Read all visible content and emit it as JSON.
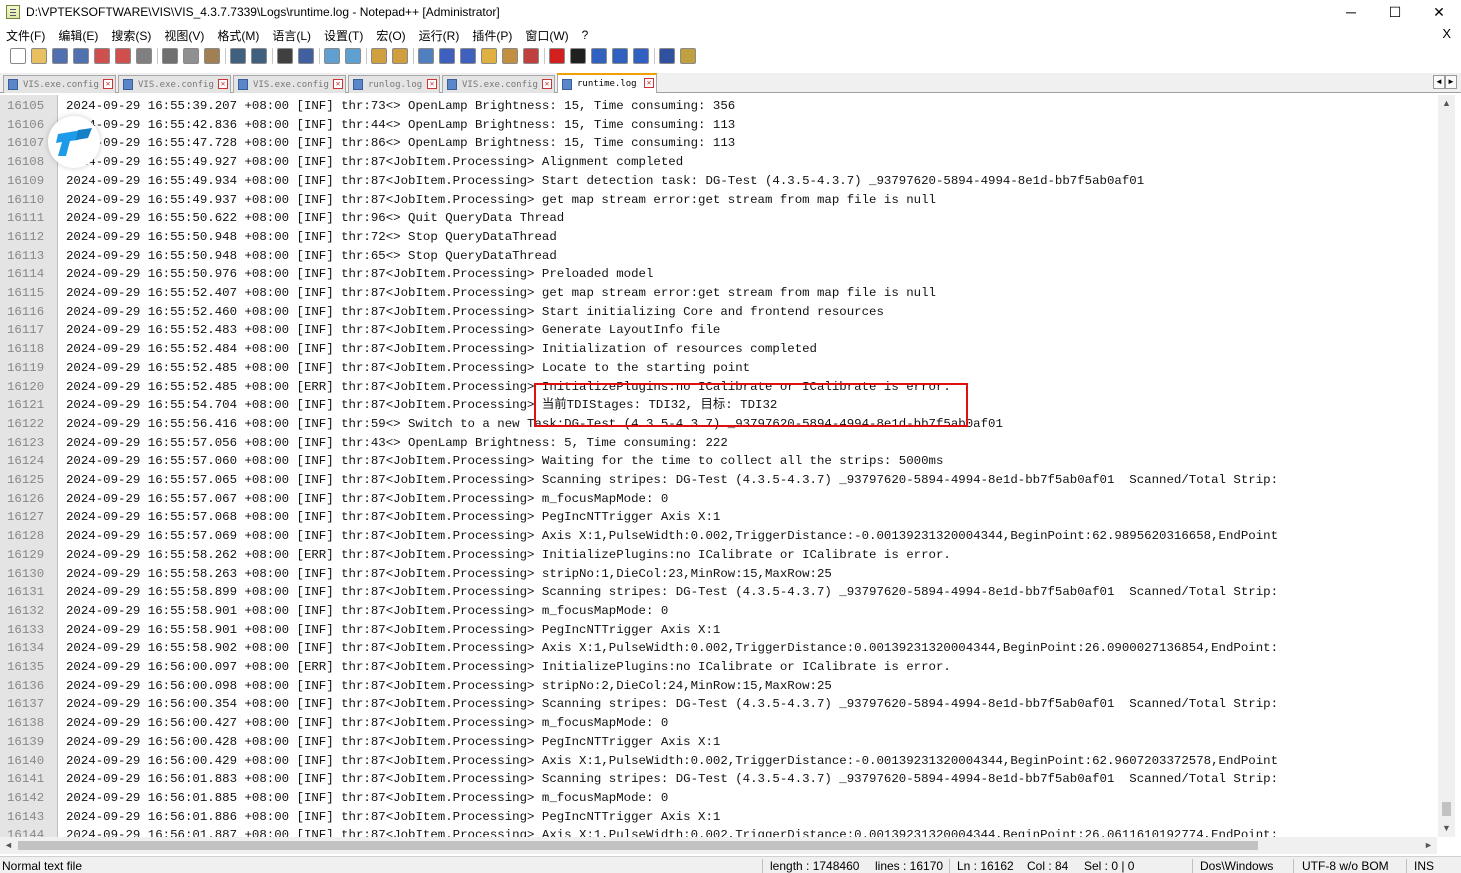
{
  "window": {
    "title": "D:\\VPTEKSOFTWARE\\VIS\\VIS_4.3.7.7339\\Logs\\runtime.log - Notepad++ [Administrator]",
    "minimize": "─",
    "maximize": "☐",
    "close": "✕"
  },
  "menu": {
    "items": [
      "文件(F)",
      "编辑(E)",
      "搜索(S)",
      "视图(V)",
      "格式(M)",
      "语言(L)",
      "设置(T)",
      "宏(O)",
      "运行(R)",
      "插件(P)",
      "窗口(W)",
      "?"
    ],
    "close_doc": "X"
  },
  "toolbar": {
    "icons": [
      {
        "name": "new-file-icon",
        "color": "#ffffff"
      },
      {
        "name": "open-file-icon",
        "color": "#e8c060"
      },
      {
        "name": "save-icon",
        "color": "#5070b0"
      },
      {
        "name": "save-all-icon",
        "color": "#5070b0"
      },
      {
        "name": "close-icon",
        "color": "#d05050"
      },
      {
        "name": "close-all-icon",
        "color": "#d05050"
      },
      {
        "name": "print-icon",
        "color": "#808080"
      },
      {
        "name": "sep",
        "color": ""
      },
      {
        "name": "cut-icon",
        "color": "#707070"
      },
      {
        "name": "copy-icon",
        "color": "#909090"
      },
      {
        "name": "paste-icon",
        "color": "#a08050"
      },
      {
        "name": "sep",
        "color": ""
      },
      {
        "name": "undo-icon",
        "color": "#406080"
      },
      {
        "name": "redo-icon",
        "color": "#406080"
      },
      {
        "name": "sep",
        "color": ""
      },
      {
        "name": "find-icon",
        "color": "#404040"
      },
      {
        "name": "replace-icon",
        "color": "#4060a0"
      },
      {
        "name": "sep",
        "color": ""
      },
      {
        "name": "zoom-in-icon",
        "color": "#60a0d0"
      },
      {
        "name": "zoom-out-icon",
        "color": "#60a0d0"
      },
      {
        "name": "sep",
        "color": ""
      },
      {
        "name": "sync-vertical-icon",
        "color": "#d0a040"
      },
      {
        "name": "sync-horizontal-icon",
        "color": "#d0a040"
      },
      {
        "name": "sep",
        "color": ""
      },
      {
        "name": "word-wrap-icon",
        "color": "#5080c0"
      },
      {
        "name": "show-all-chars-icon",
        "color": "#4060c0"
      },
      {
        "name": "indent-guide-icon",
        "color": "#4060c0"
      },
      {
        "name": "user-lang-icon",
        "color": "#e0b040"
      },
      {
        "name": "doc-map-icon",
        "color": "#c09040"
      },
      {
        "name": "function-list-icon",
        "color": "#c04040"
      },
      {
        "name": "sep",
        "color": ""
      },
      {
        "name": "record-macro-icon",
        "color": "#d02020"
      },
      {
        "name": "stop-record-icon",
        "color": "#202020"
      },
      {
        "name": "play-macro-icon",
        "color": "#3060c0"
      },
      {
        "name": "run-macro-multiple-icon",
        "color": "#3060c0"
      },
      {
        "name": "save-macro-icon",
        "color": "#3060c0"
      },
      {
        "name": "sep",
        "color": ""
      },
      {
        "name": "spell-check-icon",
        "color": "#3050a0"
      },
      {
        "name": "clipboard-history-icon",
        "color": "#c0a040"
      }
    ]
  },
  "tabs": [
    {
      "label": "VIS.exe.config",
      "active": false
    },
    {
      "label": "VIS.exe.config",
      "active": false
    },
    {
      "label": "VIS.exe.config",
      "active": false
    },
    {
      "label": "runlog.log",
      "active": false
    },
    {
      "label": "VIS.exe.config",
      "active": false
    },
    {
      "label": "runtime.log",
      "active": true
    }
  ],
  "tab_scroll": {
    "left": "◄",
    "right": "►"
  },
  "editor": {
    "lines": [
      {
        "n": "16105",
        "t": "2024-09-29 16:55:39.207 +08:00 [INF] thr:73<> OpenLamp Brightness: 15, Time consuming: 356"
      },
      {
        "n": "16106",
        "t": "2024-09-29 16:55:42.836 +08:00 [INF] thr:44<> OpenLamp Brightness: 15, Time consuming: 113"
      },
      {
        "n": "16107",
        "t": "2024-09-29 16:55:47.728 +08:00 [INF] thr:86<> OpenLamp Brightness: 15, Time consuming: 113"
      },
      {
        "n": "16108",
        "t": "2024-09-29 16:55:49.927 +08:00 [INF] thr:87<JobItem.Processing> Alignment completed"
      },
      {
        "n": "16109",
        "t": "2024-09-29 16:55:49.934 +08:00 [INF] thr:87<JobItem.Processing> Start detection task: DG-Test (4.3.5-4.3.7) _93797620-5894-4994-8e1d-bb7f5ab0af01"
      },
      {
        "n": "16110",
        "t": "2024-09-29 16:55:49.937 +08:00 [INF] thr:87<JobItem.Processing> get map stream error:get stream from map file is null"
      },
      {
        "n": "16111",
        "t": "2024-09-29 16:55:50.622 +08:00 [INF] thr:96<> Quit QueryData Thread"
      },
      {
        "n": "16112",
        "t": "2024-09-29 16:55:50.948 +08:00 [INF] thr:72<> Stop QueryDataThread"
      },
      {
        "n": "16113",
        "t": "2024-09-29 16:55:50.948 +08:00 [INF] thr:65<> Stop QueryDataThread"
      },
      {
        "n": "16114",
        "t": "2024-09-29 16:55:50.976 +08:00 [INF] thr:87<JobItem.Processing> Preloaded model"
      },
      {
        "n": "16115",
        "t": "2024-09-29 16:55:52.407 +08:00 [INF] thr:87<JobItem.Processing> get map stream error:get stream from map file is null"
      },
      {
        "n": "16116",
        "t": "2024-09-29 16:55:52.460 +08:00 [INF] thr:87<JobItem.Processing> Start initializing Core and frontend resources"
      },
      {
        "n": "16117",
        "t": "2024-09-29 16:55:52.483 +08:00 [INF] thr:87<JobItem.Processing> Generate LayoutInfo file"
      },
      {
        "n": "16118",
        "t": "2024-09-29 16:55:52.484 +08:00 [INF] thr:87<JobItem.Processing> Initialization of resources completed"
      },
      {
        "n": "16119",
        "t": "2024-09-29 16:55:52.485 +08:00 [INF] thr:87<JobItem.Processing> Locate to the starting point"
      },
      {
        "n": "16120",
        "t": "2024-09-29 16:55:52.485 +08:00 [ERR] thr:87<JobItem.Processing> InitializePlugins:no ICalibrate or ICalibrate is error."
      },
      {
        "n": "16121",
        "t": "2024-09-29 16:55:54.704 +08:00 [INF] thr:87<JobItem.Processing> 当前TDIStages: TDI32, 目标: TDI32"
      },
      {
        "n": "16122",
        "t": "2024-09-29 16:55:56.416 +08:00 [INF] thr:59<> Switch to a new Task:DG-Test (4.3.5-4.3.7) _93797620-5894-4994-8e1d-bb7f5ab0af01"
      },
      {
        "n": "16123",
        "t": "2024-09-29 16:55:57.056 +08:00 [INF] thr:43<> OpenLamp Brightness: 5, Time consuming: 222"
      },
      {
        "n": "16124",
        "t": "2024-09-29 16:55:57.060 +08:00 [INF] thr:87<JobItem.Processing> Waiting for the time to collect all the strips: 5000ms"
      },
      {
        "n": "16125",
        "t": "2024-09-29 16:55:57.065 +08:00 [INF] thr:87<JobItem.Processing> Scanning stripes: DG-Test (4.3.5-4.3.7) _93797620-5894-4994-8e1d-bb7f5ab0af01  Scanned/Total Strip:"
      },
      {
        "n": "16126",
        "t": "2024-09-29 16:55:57.067 +08:00 [INF] thr:87<JobItem.Processing> m_focusMapMode: 0"
      },
      {
        "n": "16127",
        "t": "2024-09-29 16:55:57.068 +08:00 [INF] thr:87<JobItem.Processing> PegIncNTTrigger Axis X:1"
      },
      {
        "n": "16128",
        "t": "2024-09-29 16:55:57.069 +08:00 [INF] thr:87<JobItem.Processing> Axis X:1,PulseWidth:0.002,TriggerDistance:-0.00139231320004344,BeginPoint:62.9895620316658,EndPoint"
      },
      {
        "n": "16129",
        "t": "2024-09-29 16:55:58.262 +08:00 [ERR] thr:87<JobItem.Processing> InitializePlugins:no ICalibrate or ICalibrate is error."
      },
      {
        "n": "16130",
        "t": "2024-09-29 16:55:58.263 +08:00 [INF] thr:87<JobItem.Processing> stripNo:1,DieCol:23,MinRow:15,MaxRow:25"
      },
      {
        "n": "16131",
        "t": "2024-09-29 16:55:58.899 +08:00 [INF] thr:87<JobItem.Processing> Scanning stripes: DG-Test (4.3.5-4.3.7) _93797620-5894-4994-8e1d-bb7f5ab0af01  Scanned/Total Strip:"
      },
      {
        "n": "16132",
        "t": "2024-09-29 16:55:58.901 +08:00 [INF] thr:87<JobItem.Processing> m_focusMapMode: 0"
      },
      {
        "n": "16133",
        "t": "2024-09-29 16:55:58.901 +08:00 [INF] thr:87<JobItem.Processing> PegIncNTTrigger Axis X:1"
      },
      {
        "n": "16134",
        "t": "2024-09-29 16:55:58.902 +08:00 [INF] thr:87<JobItem.Processing> Axis X:1,PulseWidth:0.002,TriggerDistance:0.00139231320004344,BeginPoint:26.0900027136854,EndPoint:"
      },
      {
        "n": "16135",
        "t": "2024-09-29 16:56:00.097 +08:00 [ERR] thr:87<JobItem.Processing> InitializePlugins:no ICalibrate or ICalibrate is error."
      },
      {
        "n": "16136",
        "t": "2024-09-29 16:56:00.098 +08:00 [INF] thr:87<JobItem.Processing> stripNo:2,DieCol:24,MinRow:15,MaxRow:25"
      },
      {
        "n": "16137",
        "t": "2024-09-29 16:56:00.354 +08:00 [INF] thr:87<JobItem.Processing> Scanning stripes: DG-Test (4.3.5-4.3.7) _93797620-5894-4994-8e1d-bb7f5ab0af01  Scanned/Total Strip:"
      },
      {
        "n": "16138",
        "t": "2024-09-29 16:56:00.427 +08:00 [INF] thr:87<JobItem.Processing> m_focusMapMode: 0"
      },
      {
        "n": "16139",
        "t": "2024-09-29 16:56:00.428 +08:00 [INF] thr:87<JobItem.Processing> PegIncNTTrigger Axis X:1"
      },
      {
        "n": "16140",
        "t": "2024-09-29 16:56:00.429 +08:00 [INF] thr:87<JobItem.Processing> Axis X:1,PulseWidth:0.002,TriggerDistance:-0.00139231320004344,BeginPoint:62.9607203372578,EndPoint"
      },
      {
        "n": "16141",
        "t": "2024-09-29 16:56:01.883 +08:00 [INF] thr:87<JobItem.Processing> Scanning stripes: DG-Test (4.3.5-4.3.7) _93797620-5894-4994-8e1d-bb7f5ab0af01  Scanned/Total Strip:"
      },
      {
        "n": "16142",
        "t": "2024-09-29 16:56:01.885 +08:00 [INF] thr:87<JobItem.Processing> m_focusMapMode: 0"
      },
      {
        "n": "16143",
        "t": "2024-09-29 16:56:01.886 +08:00 [INF] thr:87<JobItem.Processing> PegIncNTTrigger Axis X:1"
      },
      {
        "n": "16144",
        "t": "2024-09-29 16:56:01.887 +08:00 [INF] thr:87<JobItem.Processing> Axis X:1,PulseWidth:0.002,TriggerDistance:0.00139231320004344,BeginPoint:26.0611610192774,EndPoint:"
      }
    ]
  },
  "scrollbars": {
    "up": "▲",
    "down": "▼",
    "left": "◄",
    "right": "►"
  },
  "status": {
    "file_type": "Normal text file",
    "length": "length : 1748460",
    "lines": "lines : 16170",
    "ln": "Ln : 16162",
    "col": "Col : 84",
    "sel": "Sel : 0 | 0",
    "eol": "Dos\\Windows",
    "encoding": "UTF-8 w/o BOM",
    "mode": "INS"
  },
  "colors": {
    "gutter": "#e4e4e4",
    "highlight_border": "#e01010",
    "active_tab_accent": "#f0a000",
    "logo_blue": "#1e9be8"
  }
}
